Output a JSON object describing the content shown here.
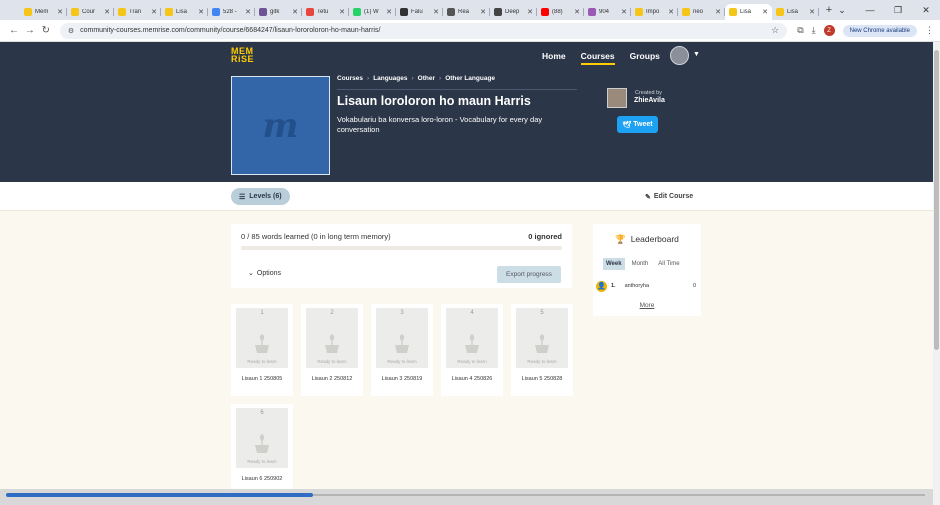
{
  "browser": {
    "tabs": [
      {
        "label": "Mem",
        "color": "#f5c518",
        "active": false
      },
      {
        "label": "Cour",
        "color": "#f5c518",
        "active": false
      },
      {
        "label": "Tran",
        "color": "#f5c518",
        "active": false
      },
      {
        "label": "Lisa",
        "color": "#f5c518",
        "active": false
      },
      {
        "label": "528 -",
        "color": "#4285f4",
        "active": false
      },
      {
        "label": "gitk",
        "color": "#6e5494",
        "active": false
      },
      {
        "label": "Tetu",
        "color": "#e8453c",
        "active": false
      },
      {
        "label": "(1) W",
        "color": "#25d366",
        "active": false
      },
      {
        "label": "Falu",
        "color": "#333333",
        "active": false
      },
      {
        "label": "Rea",
        "color": "#555555",
        "active": false
      },
      {
        "label": "Deep",
        "color": "#444444",
        "active": false
      },
      {
        "label": "(88)",
        "color": "#ff0000",
        "active": false
      },
      {
        "label": "904",
        "color": "#9b59b6",
        "active": false
      },
      {
        "label": "Impo",
        "color": "#f5c518",
        "active": false
      },
      {
        "label": "neo",
        "color": "#f5c518",
        "active": false
      },
      {
        "label": "Lisa",
        "color": "#f5c518",
        "active": true
      },
      {
        "label": "Lisa",
        "color": "#f5c518",
        "active": false
      }
    ],
    "url": "community-courses.memrise.com/community/course/6684247/lisaun-lororoloron-ho-maun-harris/",
    "profile_initial": "Z",
    "update_label": "New Chrome available"
  },
  "site": {
    "logo_line1": "MEM",
    "logo_line2": "RiSE",
    "nav": [
      "Home",
      "Courses",
      "Groups"
    ]
  },
  "course": {
    "thumb_letter": "m",
    "breadcrumbs": [
      "Courses",
      "Languages",
      "Other",
      "Other Language"
    ],
    "title": "Lisaun loroloron ho maun Harris",
    "description": "Vokabulariu ba konversa loro-loron - Vocabulary for every day conversation",
    "created_by_label": "Created by",
    "creator": "ZhieAvila",
    "tweet_label": "Tweet"
  },
  "levels_bar": {
    "levels_label": "Levels (6)",
    "edit_label": "Edit Course"
  },
  "progress": {
    "words_learned": "0 / 85 words learned (0 in long term memory)",
    "ignored": "0 ignored",
    "fraction": 0,
    "options_label": "Options",
    "export_label": "Export progress"
  },
  "leaderboard": {
    "title": "Leaderboard",
    "tabs": [
      "Week",
      "Month",
      "All Time"
    ],
    "entries": [
      {
        "rank": "1.",
        "user": "anthoryha",
        "score": "0"
      }
    ],
    "more_label": "More"
  },
  "levels": [
    {
      "num": "1",
      "status": "Ready to learn",
      "name": "Lisaun 1 250805"
    },
    {
      "num": "2",
      "status": "Ready to learn",
      "name": "Lisaun 2 250812"
    },
    {
      "num": "3",
      "status": "Ready to learn",
      "name": "Lisaun 3 250819"
    },
    {
      "num": "4",
      "status": "Ready to learn",
      "name": "Lisaun 4 250826"
    },
    {
      "num": "5",
      "status": "Ready to learn",
      "name": "Lisaun 5 250828"
    },
    {
      "num": "6",
      "status": "Ready to learn",
      "name": "Lisaun 6 250902"
    }
  ],
  "colors": {
    "header_bg": "#2b3648",
    "accent": "#ffcc00",
    "tweet": "#1da1f2",
    "page_bg": "#fbf8ef"
  }
}
